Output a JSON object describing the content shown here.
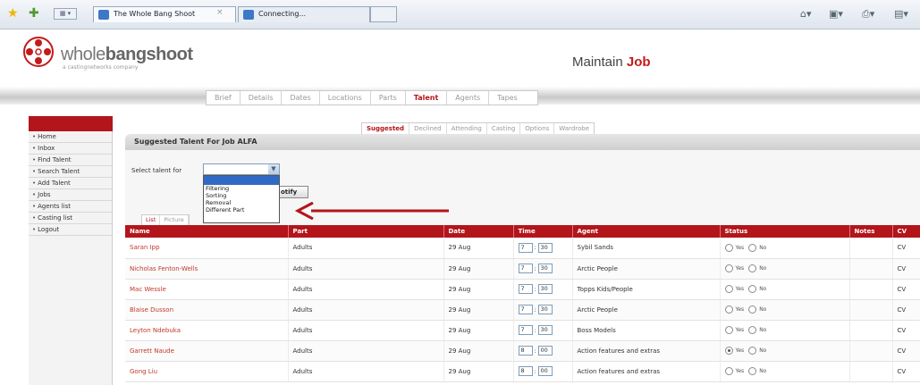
{
  "browser": {
    "tabs": [
      {
        "title": "The Whole Bang Shoot"
      },
      {
        "title": "Connecting..."
      }
    ],
    "close_glyph": "×",
    "icons": [
      "favorites-star-icon",
      "add-favorites-icon",
      "tab-list-icon",
      "home-icon",
      "feeds-icon",
      "print-icon",
      "page-menu-icon"
    ]
  },
  "header": {
    "logo_prefix": "whole",
    "logo_bold": "bangshoot",
    "logo_tagline": "a castingnetworks company",
    "title_prefix": "Maintain ",
    "title_bold": "Job"
  },
  "job_tabs": [
    "Brief",
    "Details",
    "Dates",
    "Locations",
    "Parts",
    "Talent",
    "Agents",
    "Tapes"
  ],
  "job_tabs_active": "Talent",
  "sidebar": {
    "items": [
      {
        "label": "Home"
      },
      {
        "label": "Inbox"
      },
      {
        "label": "Find Talent"
      },
      {
        "label": "Search Talent"
      },
      {
        "label": "Add Talent"
      },
      {
        "label": "Jobs"
      },
      {
        "label": "Agents list"
      },
      {
        "label": "Casting list"
      },
      {
        "label": "Logout"
      }
    ]
  },
  "sub_tabs": [
    "Suggested",
    "Declined",
    "Attending",
    "Casting",
    "Options",
    "Wardrobe"
  ],
  "sub_tabs_active": "Suggested",
  "panel": {
    "title": "Suggested Talent For Job ALFA",
    "select_label": "Select talent for",
    "select_value": "",
    "select_options": [
      "Filtering",
      "Sorting",
      "Removal",
      "Different Part"
    ],
    "notify_label": "otify",
    "view_tabs": [
      "List",
      "Picture"
    ]
  },
  "table": {
    "headers": [
      "Name",
      "Part",
      "Date",
      "Time",
      "Agent",
      "Status",
      "Notes",
      "CV"
    ],
    "status_labels": {
      "yes": "Yes",
      "no": "No"
    },
    "cv_label": "CV",
    "rows": [
      {
        "name": "Saran Ipp",
        "part": "Adults",
        "date": "29 Aug",
        "hour": "7",
        "min": "30",
        "agent": "Sybil Sands",
        "status": "none"
      },
      {
        "name": "Nicholas Fenton-Wells",
        "part": "Adults",
        "date": "29 Aug",
        "hour": "7",
        "min": "30",
        "agent": "Arctic People",
        "status": "none"
      },
      {
        "name": "Mac Wessle",
        "part": "Adults",
        "date": "29 Aug",
        "hour": "7",
        "min": "30",
        "agent": "Topps Kids/People",
        "status": "none"
      },
      {
        "name": "Blaise Dusson",
        "part": "Adults",
        "date": "29 Aug",
        "hour": "7",
        "min": "30",
        "agent": "Arctic People",
        "status": "none"
      },
      {
        "name": "Leyton Ndebuka",
        "part": "Adults",
        "date": "29 Aug",
        "hour": "7",
        "min": "30",
        "agent": "Boss Models",
        "status": "none"
      },
      {
        "name": "Garrett Naude",
        "part": "Adults",
        "date": "29 Aug",
        "hour": "8",
        "min": "00",
        "agent": "Action features and extras",
        "status": "yes"
      },
      {
        "name": "Gong Liu",
        "part": "Adults",
        "date": "29 Aug",
        "hour": "8",
        "min": "00",
        "agent": "Action features and extras",
        "status": "none"
      }
    ]
  },
  "colors": {
    "accent": "#b3151b",
    "link": "#c0392b",
    "arrow": "#b3151b"
  }
}
